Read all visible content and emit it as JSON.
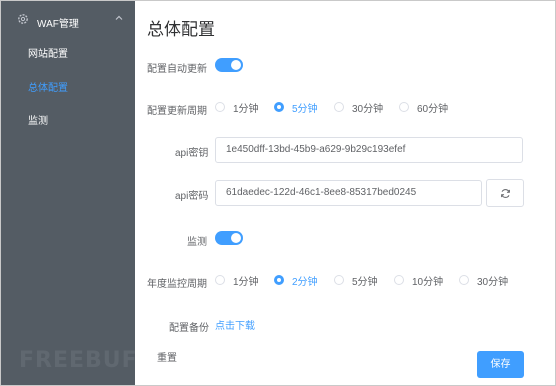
{
  "sidebar": {
    "header_title": "WAF管理",
    "items": [
      {
        "label": "网站配置"
      },
      {
        "label": "总体配置"
      },
      {
        "label": "监测"
      }
    ]
  },
  "main": {
    "title": "总体配置",
    "auto_update_label": "配置自动更新",
    "update_period_label": "配置更新周期",
    "update_period_options": [
      "1分钟",
      "5分钟",
      "30分钟",
      "60分钟"
    ],
    "update_period_selected": "5分钟",
    "api_key_label": "api密钥",
    "api_key_value": "1e450dff-13bd-45b9-a629-9b29c193efef",
    "api_password_label": "api密码",
    "api_password_value": "61daedec-122d-46c1-8ee8-85317bed0245",
    "monitor_label": "监测",
    "annual_period_label": "年度监控周期",
    "annual_period_options": [
      "1分钟",
      "2分钟",
      "5分钟",
      "10分钟",
      "30分钟"
    ],
    "annual_period_selected": "2分钟",
    "backup_label": "配置备份",
    "backup_link": "点击下载",
    "reset_label": "重置",
    "save_label": "保存"
  },
  "colors": {
    "sidebar_bg": "#545c64",
    "accent": "#409eff",
    "text": "#606266"
  },
  "icons": [
    "gear-icon",
    "chevron-up-icon",
    "refresh-icon"
  ]
}
